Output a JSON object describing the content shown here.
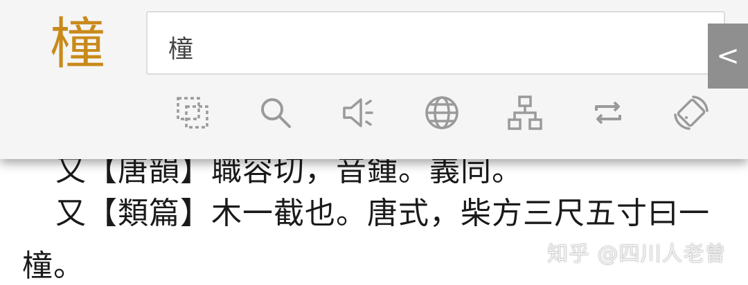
{
  "document": {
    "line_partial": "又【唐韻】職容切，音鍾。義同。",
    "line_main": "又【類篇】木一截也。唐式，柴方三尺五寸曰一",
    "line_end": "橦。"
  },
  "popup": {
    "headword": "橦",
    "search_value": "橦",
    "collapse_label": "<",
    "colors": {
      "headword": "#c98a1a",
      "icon": "#9a9a9a",
      "panel_bg": "#f5f5f5",
      "tab_bg": "#8f8f8f"
    },
    "toolbar_icons": [
      "select-copy-icon",
      "search-icon",
      "speaker-icon",
      "globe-icon",
      "sitemap-icon",
      "repeat-icon",
      "rotate-icon"
    ]
  },
  "watermark": "知乎 @四川人老曾"
}
